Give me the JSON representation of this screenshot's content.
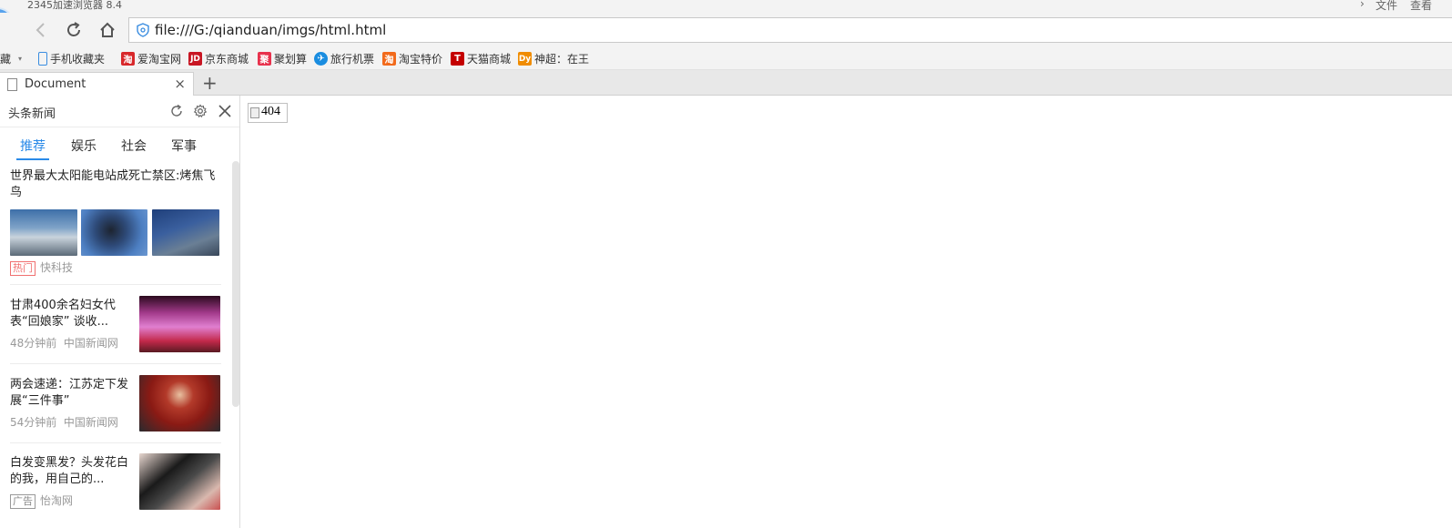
{
  "window": {
    "app_title": "2345加速浏览器 8.4",
    "menu_file": "文件",
    "menu_view": "查看"
  },
  "address": {
    "url": "file:///G:/qianduan/imgs/html.html"
  },
  "bookmarks": {
    "favorites_label": "藏",
    "items": [
      {
        "label": "手机收藏夹",
        "icon": "phone-icon"
      },
      {
        "label": "爱淘宝网",
        "icon": "taobao-icon",
        "color": "#d8282b"
      },
      {
        "label": "京东商城",
        "icon": "jd-icon",
        "color": "#c81623"
      },
      {
        "label": "聚划算",
        "icon": "juhuasuan-icon",
        "color": "#e8324d"
      },
      {
        "label": "旅行机票",
        "icon": "travel-icon",
        "color": "#1a8de0"
      },
      {
        "label": "淘宝特价",
        "icon": "taobao-sale-icon",
        "color": "#f26a1b"
      },
      {
        "label": "天猫商城",
        "icon": "tmall-icon",
        "color": "#c40000"
      },
      {
        "label": "神超：在王",
        "icon": "douyu-icon",
        "color": "#f08c00"
      }
    ]
  },
  "tabs": [
    {
      "label": "Document",
      "active": true
    }
  ],
  "newtab_label": "+",
  "sidebar": {
    "title": "头条新闻",
    "tabs": [
      "推荐",
      "娱乐",
      "社会",
      "军事"
    ],
    "active_tab": "推荐",
    "news": [
      {
        "title": "世界最大太阳能电站成死亡禁区:烤焦飞鸟",
        "tag": "热门",
        "source": "快科技"
      },
      {
        "title": "甘肃400余名妇女代表“回娘家” 谈收...",
        "time": "48分钟前",
        "source": "中国新闻网"
      },
      {
        "title": "两会速递：江苏定下发展“三件事”",
        "time": "54分钟前",
        "source": "中国新闻网"
      },
      {
        "title": "白发变黑发？头发花白的我，用自己的...",
        "tag": "广告",
        "source": "怡淘网"
      }
    ]
  },
  "content": {
    "broken_image_alt": "404"
  },
  "colors": {
    "accent": "#2a8ae8",
    "hot_tag": "#f07070"
  }
}
